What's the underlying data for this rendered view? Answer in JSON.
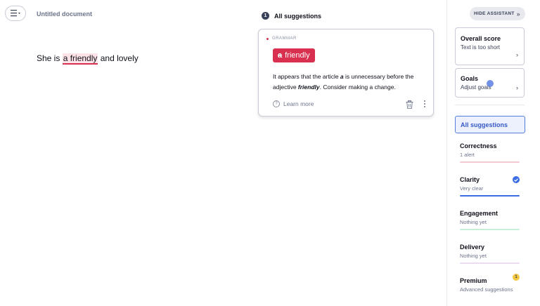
{
  "document": {
    "title": "Untitled document",
    "text_before": "She is ",
    "text_highlight": "a friendly",
    "text_after": " and lovely"
  },
  "suggestions": {
    "count": "1",
    "header": "All suggestions",
    "card": {
      "category": "GRAMMAR",
      "chip_strike": "a",
      "chip_word": "friendly",
      "explain_1": "It appears that the article ",
      "explain_article": "a",
      "explain_2": " is unnecessary before the adjective ",
      "explain_word": "friendly",
      "explain_3": ". Consider making a change.",
      "learn_more": "Learn more"
    }
  },
  "sidebar": {
    "hide_label": "HIDE ASSISTANT",
    "hide_chevron": "»",
    "overall_score": {
      "title": "Overall score",
      "subtitle": "Text is too short"
    },
    "goals": {
      "title": "Goals",
      "subtitle": "Adjust goals"
    },
    "all_suggestions": "All suggestions",
    "categories": [
      {
        "name": "Correctness",
        "status": "1 alert",
        "bar_color": "#f5c9d1"
      },
      {
        "name": "Clarity",
        "status": "Very clear",
        "bar_color": "#3b6ee3"
      },
      {
        "name": "Engagement",
        "status": "Nothing yet",
        "bar_color": "#c9efd8"
      },
      {
        "name": "Delivery",
        "status": "Nothing yet",
        "bar_color": "#ecdcf2"
      }
    ],
    "premium": {
      "name": "Premium",
      "status": "Advanced suggestions",
      "badge": "1"
    }
  },
  "colors": {
    "alert_red": "#d9304f",
    "accent_blue": "#3b6ee3",
    "premium_yellow": "#f4c842"
  }
}
